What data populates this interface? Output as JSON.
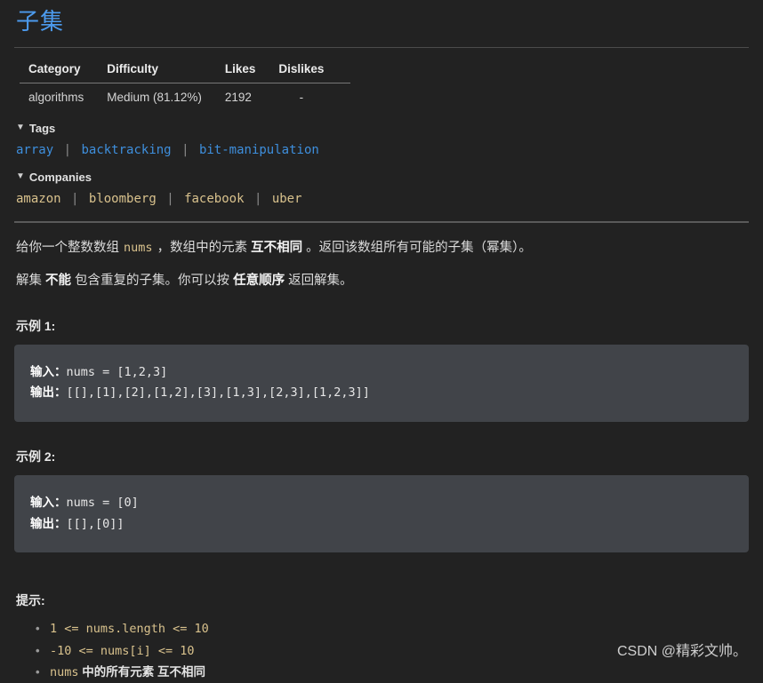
{
  "problem": {
    "title": "子集"
  },
  "meta_table": {
    "headers": [
      "Category",
      "Difficulty",
      "Likes",
      "Dislikes"
    ],
    "row": {
      "category": "algorithms",
      "difficulty": "Medium (81.12%)",
      "likes": "2192",
      "dislikes": "-"
    }
  },
  "tags_section": {
    "triangle": "▼",
    "label": "Tags",
    "items": [
      "array",
      "backtracking",
      "bit-manipulation"
    ],
    "separator": "|",
    "color": "#3e8fdd"
  },
  "companies_section": {
    "triangle": "▼",
    "label": "Companies",
    "items": [
      "amazon",
      "bloomberg",
      "facebook",
      "uber"
    ],
    "separator": "|",
    "color": "#d9c28d"
  },
  "description": {
    "p1_a": "给你一个整数数组 ",
    "p1_code": "nums",
    "p1_b": " ，数组中的元素 ",
    "p1_bold": "互不相同",
    "p1_c": " 。返回该数组所有可能的子集（幂集）。",
    "p2_a": "解集 ",
    "p2_bold1": "不能",
    "p2_b": " 包含重复的子集。你可以按 ",
    "p2_bold2": "任意顺序",
    "p2_c": " 返回解集。"
  },
  "examples": [
    {
      "title": "示例 1:",
      "input_label": "输入：",
      "input_value": "nums = [1,2,3]",
      "output_label": "输出：",
      "output_value": "[[],[1],[2],[1,2],[3],[1,3],[2,3],[1,2,3]]"
    },
    {
      "title": "示例 2:",
      "input_label": "输入：",
      "input_value": "nums = [0]",
      "output_label": "输出：",
      "output_value": "[[],[0]]"
    }
  ],
  "hints": {
    "title": "提示:",
    "items": [
      {
        "code": "1 <= nums.length <= 10",
        "text": ""
      },
      {
        "code": "-10 <= nums[i] <= 10",
        "text": ""
      },
      {
        "code": "nums",
        "text": " 中的所有元素 互不相同"
      }
    ]
  },
  "watermark": {
    "text": "CSDN @精彩文帅。"
  }
}
